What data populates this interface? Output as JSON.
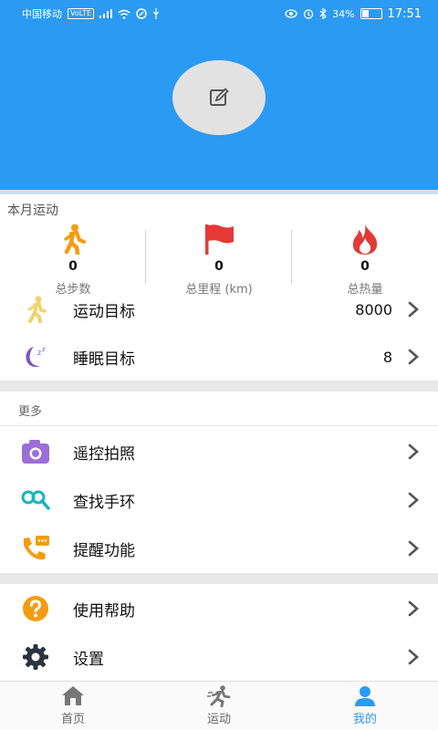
{
  "status_bar": {
    "carrier": "中国移动",
    "volte": "VoLTE",
    "battery": "34%",
    "time": "17:51"
  },
  "colors": {
    "accent": "#2b9af3",
    "walk": "#f39c12",
    "flag": "#e53935",
    "fire": "#e53935"
  },
  "monthly": {
    "title": "本月运动",
    "stats": [
      {
        "icon": "walking-person-icon",
        "value": "0",
        "label": "总步数"
      },
      {
        "icon": "red-flag-icon",
        "value": "0",
        "label": "总里程 (km)"
      },
      {
        "icon": "fire-icon",
        "value": "0",
        "label": "总热量"
      }
    ]
  },
  "goals": [
    {
      "icon": "exercise-goal-icon",
      "label": "运动目标",
      "value": "8000"
    },
    {
      "icon": "sleep-moon-icon",
      "label": "睡眠目标",
      "value": "8"
    }
  ],
  "more": {
    "title": "更多",
    "items": [
      {
        "icon": "camera-icon",
        "label": "遥控拍照"
      },
      {
        "icon": "find-band-icon",
        "label": "查找手环"
      },
      {
        "icon": "reminder-phone-icon",
        "label": "提醒功能"
      }
    ]
  },
  "misc": [
    {
      "icon": "help-icon",
      "label": "使用帮助"
    },
    {
      "icon": "gear-icon",
      "label": "设置"
    }
  ],
  "tabs": [
    {
      "icon": "home-icon",
      "label": "首页",
      "active": false
    },
    {
      "icon": "running-icon",
      "label": "运动",
      "active": false
    },
    {
      "icon": "profile-icon",
      "label": "我的",
      "active": true
    }
  ]
}
